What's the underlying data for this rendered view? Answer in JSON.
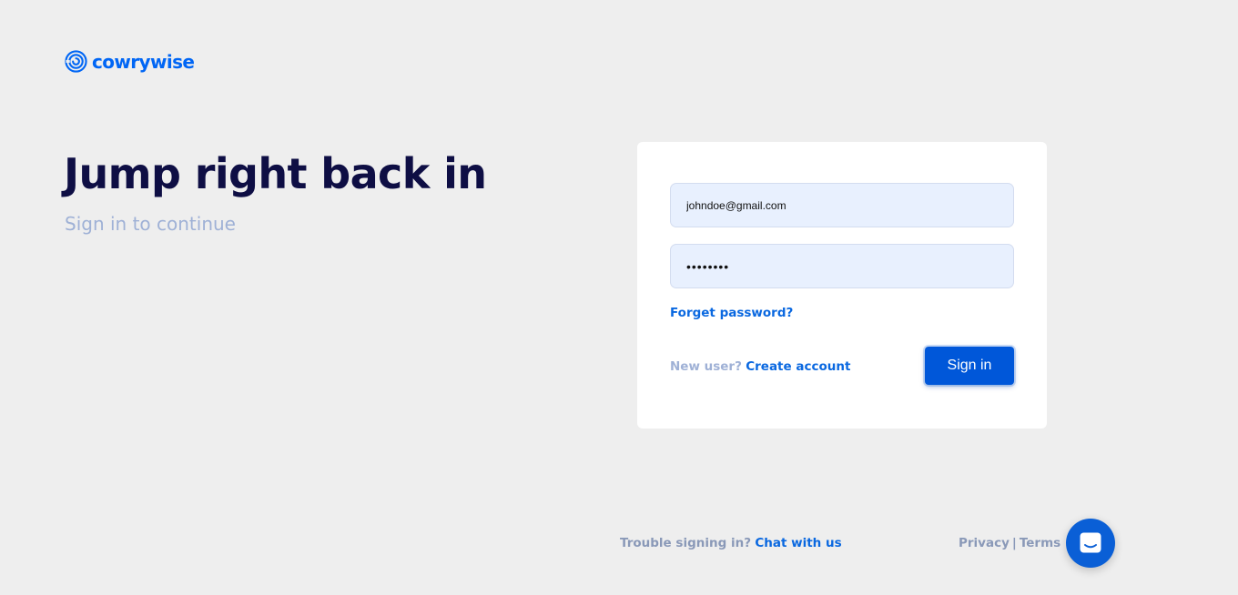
{
  "brand": {
    "name": "cowrywise",
    "accent_color": "#0066f5",
    "logo_icon": "cowrywise-logo-icon"
  },
  "hero": {
    "title": "Jump right back in",
    "subtitle": "Sign in to continue"
  },
  "form": {
    "email_value": "johndoe@gmail.com",
    "password_value": "••••••••",
    "forgot_label": "Forget password?",
    "new_user_prompt": "New user?",
    "create_account_label": "Create account",
    "signin_label": "Sign in"
  },
  "footer": {
    "trouble_prompt": "Trouble signing in?",
    "chat_label": "Chat with us",
    "privacy_label": "Privacy",
    "separator": "|",
    "terms_label": "Terms"
  },
  "chat_widget": {
    "icon": "chat-bubble-icon",
    "color": "#0a5fd6"
  }
}
